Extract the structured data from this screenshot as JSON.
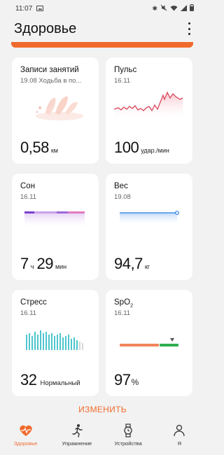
{
  "status_bar": {
    "time": "11:07"
  },
  "header": {
    "title": "Здоровье"
  },
  "cards": {
    "workouts": {
      "title": "Записи занятий",
      "subtitle": "19.08 Ходьба в по...",
      "value": "0,58",
      "unit": "км"
    },
    "pulse": {
      "title": "Пульс",
      "subtitle": "16.11",
      "value": "100",
      "unit": "удар./мин"
    },
    "sleep": {
      "title": "Сон",
      "subtitle": "16.11",
      "hours": "7",
      "hours_unit": "ч",
      "minutes": "29",
      "minutes_unit": "мин"
    },
    "weight": {
      "title": "Вес",
      "subtitle": "19.08",
      "value": "94,7",
      "unit": "кг"
    },
    "stress": {
      "title": "Стресс",
      "subtitle": "16.11",
      "value": "32",
      "unit": "Нормальный"
    },
    "spo2": {
      "title_main": "SpO",
      "title_sub": "2",
      "subtitle": "16.11",
      "value": "97",
      "unit": "%"
    }
  },
  "edit_label": "ИЗМЕНИТЬ",
  "nav": [
    {
      "label": "Здоровье",
      "icon": "heart-pulse-icon",
      "active": true
    },
    {
      "label": "Упражнение",
      "icon": "running-person-icon",
      "active": false
    },
    {
      "label": "Устройства",
      "icon": "watch-icon",
      "active": false
    },
    {
      "label": "Я",
      "icon": "person-icon",
      "active": false
    }
  ],
  "colors": {
    "accent": "#f06a2d",
    "pulse": "#d8485c",
    "sleep_deep": "#7a3fcf",
    "sleep_light": "#c9a4e8",
    "weight": "#2a7de1",
    "stress": "#4fc5cf",
    "spo2_orange": "#f0855a",
    "spo2_green": "#2fae4f"
  }
}
